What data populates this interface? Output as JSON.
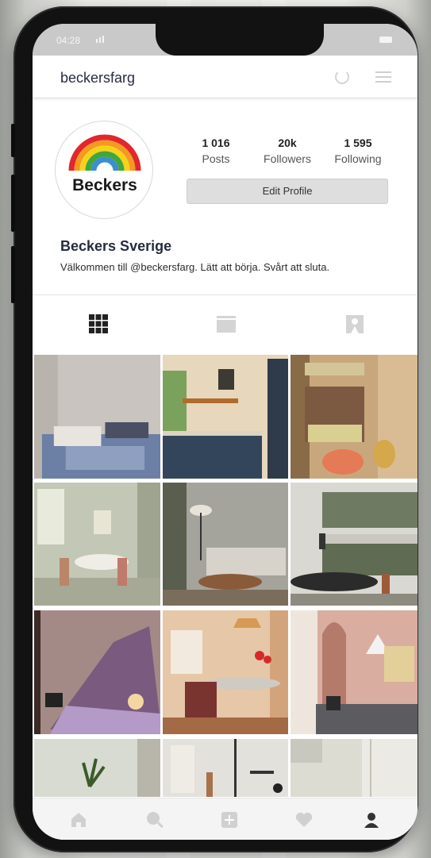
{
  "status_bar": {
    "time": "04:28"
  },
  "header": {
    "username": "beckersfarg"
  },
  "profile": {
    "avatar_text": "Beckers",
    "stats": [
      {
        "value": "1 016",
        "label": "Posts"
      },
      {
        "value": "20k",
        "label": "Followers"
      },
      {
        "value": "1 595",
        "label": "Following"
      }
    ],
    "edit_button": "Edit Profile",
    "name": "Beckers Sverige",
    "bio": "Välkommen till @beckersfarg. Lätt att börja. Svårt att sluta."
  },
  "tabs": [
    "grid-icon",
    "feed-icon",
    "tagged-icon"
  ],
  "bottom_nav": [
    "home-icon",
    "search-icon",
    "add-post-icon",
    "heart-icon",
    "profile-icon"
  ],
  "colors": {
    "primary_text": "#262d3d",
    "button_bg": "#dedede",
    "rainbow": [
      "#e3262d",
      "#f39a1f",
      "#f7d21c",
      "#41a63c",
      "#3b8fd0"
    ]
  }
}
